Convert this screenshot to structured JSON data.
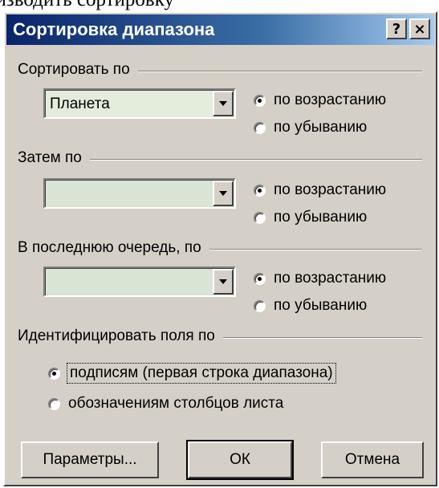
{
  "page_text": "оизводить сортировку",
  "dialog": {
    "title": "Сортировка диапазона",
    "help_label": "?",
    "close_label": "×"
  },
  "groups": [
    {
      "label": "Сортировать по",
      "combo_value": "Планета",
      "asc_label": "по возрастанию",
      "desc_label": "по убыванию",
      "selected": "asc"
    },
    {
      "label": "Затем по",
      "combo_value": "",
      "asc_label": "по возрастанию",
      "desc_label": "по убыванию",
      "selected": "asc"
    },
    {
      "label": "В последнюю очередь, по",
      "combo_value": "",
      "asc_label": "по возрастанию",
      "desc_label": "по убыванию",
      "selected": "asc"
    }
  ],
  "identify": {
    "label": "Идентифицировать поля по",
    "option_headers": "подписям (первая строка диапазона)",
    "option_columns": "обозначениям столбцов листа",
    "selected": "headers"
  },
  "buttons": {
    "params": "Параметры...",
    "ok": "ОК",
    "cancel": "Отмена"
  }
}
